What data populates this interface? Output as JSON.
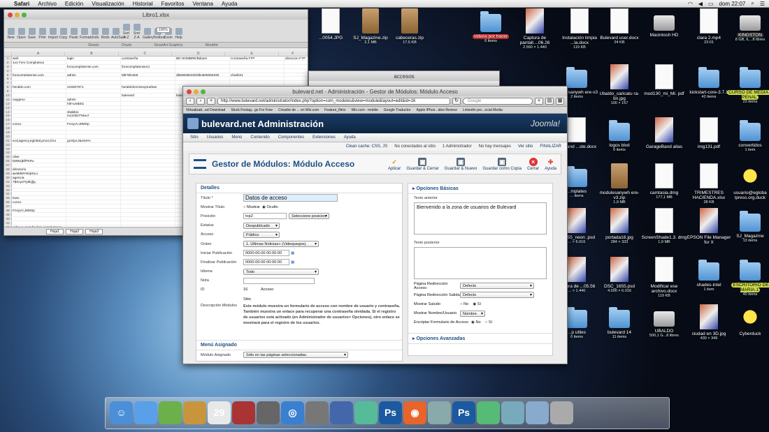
{
  "menubar": {
    "apple": "",
    "app": "Safari",
    "items": [
      "Archivo",
      "Edición",
      "Visualización",
      "Historial",
      "Favoritos",
      "Ventana",
      "Ayuda"
    ],
    "clock": "dom 22:07"
  },
  "excel": {
    "title": "Libro1.xlsx",
    "zoom": "100%",
    "toolbar": [
      "New",
      "Open",
      "Save",
      "Print",
      "Import",
      "Copy",
      "Paste",
      "Format",
      "Undo",
      "Redo",
      "AutoSum",
      "Sort A-Z",
      "Sort Z-A",
      "Gallery",
      "Toolbox",
      "Zoom",
      "Help"
    ],
    "ribbon": [
      "Sheets",
      "Charts",
      "SmartArt Graphics",
      "WordArt"
    ],
    "columns": [
      "A",
      "B",
      "C",
      "D",
      "E",
      "F"
    ],
    "rows": [
      [
        "web",
        "login",
        "contraseña",
        "BD NOMBRE/Bduser",
        "Contraseña FTP",
        "direccion FTP"
      ],
      [
        "1x1 Foro Compluteca",
        "",
        "",
        "",
        "",
        ""
      ],
      [
        "",
        "forocomplutense.com",
        "forocomplutense13",
        "",
        "",
        ""
      ],
      [
        "",
        "",
        "",
        "",
        "",
        ""
      ],
      [
        "forocomplutense.com",
        "admin",
        "Mk*9lmnk8",
        "db506056330/dbo506056330",
        "charliet1",
        ""
      ],
      [
        "",
        "",
        "",
        "",
        "",
        ""
      ],
      [
        "",
        "",
        "",
        "",
        "",
        ""
      ],
      [
        "heraldo.com",
        "218257971",
        "heraldoherrarecpruebas",
        "",
        "",
        ""
      ],
      [
        "",
        "",
        "",
        "",
        "",
        ""
      ],
      [
        "",
        "",
        "bulevard",
        "bulevard41",
        "3Ev9(@)P5d+QEd",
        ""
      ],
      [
        "oxygeno",
        "admin",
        "",
        "",
        "",
        ""
      ],
      [
        "",
        "hik*xJe$4t1",
        "",
        "",
        "",
        ""
      ],
      [
        "",
        "",
        "",
        "",
        "",
        ""
      ],
      [
        "",
        "sbabbio",
        "",
        "",
        "",
        ""
      ],
      [
        "",
        "mv)VkD7'Mvu7",
        "",
        "",
        "",
        ""
      ],
      [
        "",
        "",
        "",
        "",
        "",
        ""
      ],
      [
        "conco",
        "FnnyvV,J8MOp",
        "",
        "",
        "",
        ""
      ],
      [
        "",
        "",
        "",
        "",
        "",
        ""
      ],
      [
        "",
        "",
        "",
        "",
        "",
        ""
      ],
      [
        "",
        "",
        "",
        "",
        "",
        ""
      ],
      [
        "ecd,agency,eglobal,proxs,foro",
        "gUXjxL3&Jsm%",
        "",
        "",
        "",
        ""
      ],
      [
        "",
        "",
        "",
        "",
        "",
        ""
      ],
      [
        "",
        "",
        "",
        "",
        "",
        ""
      ],
      [
        "",
        "",
        "",
        "",
        "",
        ""
      ],
      [
        "olive",
        "",
        "",
        "",
        "",
        ""
      ],
      [
        "D8WxjEfPKRu",
        "",
        "",
        "",
        "",
        ""
      ],
      [
        "",
        "",
        "",
        "",
        "",
        ""
      ],
      [
        "directorio",
        "",
        "",
        "",
        "",
        ""
      ],
      [
        "&xMdMYWqHtLu",
        "",
        "",
        "",
        "",
        ""
      ],
      [
        "agencia",
        "",
        "",
        "",
        "",
        ""
      ],
      [
        "7$XcyOTy5kj||q",
        "",
        "",
        "",
        "",
        ""
      ],
      [
        "",
        "",
        "",
        "",
        "",
        ""
      ],
      [
        "",
        "",
        "",
        "",
        "",
        ""
      ],
      [
        "",
        "",
        "",
        "",
        "",
        ""
      ],
      [
        "lowo",
        "",
        "",
        "",
        "",
        ""
      ],
      [
        "conco",
        "",
        "",
        "",
        "",
        ""
      ],
      [
        "",
        "",
        "",
        "",
        "",
        ""
      ],
      [
        "FnnyvV,J8MOp",
        "",
        "",
        "",
        "",
        ""
      ],
      [
        "",
        "",
        "",
        "",
        "",
        ""
      ],
      [
        "",
        "",
        "",
        "",
        "",
        ""
      ],
      [
        "",
        "",
        "",
        "",
        "",
        ""
      ],
      [
        "video a youtube foro complutense",
        "",
        "",
        "",
        "",
        ""
      ],
      [
        "qj7vr6vTIR%ojm.youtube.com",
        "",
        "",
        "",
        "",
        ""
      ]
    ],
    "sheets": [
      "Hoja1",
      "Hoja2",
      "Hoja3"
    ]
  },
  "finder": {
    "title": "accesos"
  },
  "browser": {
    "title": "bulevard.net - Administración - Gestor de Módulos: Módulo Acceso",
    "url": "http://www.bulevard.net/administrator/index.php?option=com_modules&view=module&layout=edit&id=16",
    "search_placeholder": "Google",
    "bookmarks": [
      "Virtualizati...ed Download",
      "Stock Footag...go For Free",
      "Creador de ... en Wix.com",
      "Feature_films",
      "Wix.com - mobile",
      "Google Traductor",
      "Apple iPhon...ideo Review",
      "LinkedIn pro...ocial Media"
    ],
    "site_name": "bulevard.net Administración",
    "joomla": "Joomla!",
    "menu": [
      "Sitio",
      "Usuarios",
      "Menú",
      "Contenido",
      "Componentes",
      "Extensiones",
      "Ayuda"
    ],
    "status": [
      "Clean cache: CSS, JS",
      "No conectados al sitio",
      "1 Administrador",
      "No hay mensajes",
      "Ver sitio",
      "FINALIZAR"
    ],
    "page_title": "Gestor de Módulos: Módulo Acceso",
    "tools": [
      "Aplicar",
      "Guardar & Cerrar",
      "Guardar & Nuevo",
      "Guardar como Copia",
      "Cerrar",
      "Ayuda"
    ],
    "details": {
      "header": "Detalles",
      "titulo_label": "Título",
      "titulo": "Datos de acceso",
      "mostrar_label": "Mostrar Título",
      "mostrar": "Mostrar",
      "oculto": "Oculto",
      "posicion_label": "Posición",
      "posicion": "top2",
      "sel_pos": "Seleccione posicion",
      "estatus_label": "Estatus",
      "estatus": "Despublicado",
      "acceso_label": "Acceso",
      "acceso": "Público",
      "orden_label": "Orden",
      "orden": "1. Ultimas Noticias+ (Videojuegos)",
      "inicio_label": "Iniciar Publicación",
      "inicio": "0000-00-00 00:00:00",
      "fin_label": "Finalizar Publicación",
      "fin": "0000-00-00 00:00:00",
      "idioma_label": "Idioma",
      "idioma": "Todo",
      "nota_label": "Nota",
      "id_label": "ID",
      "id": "16",
      "id_type": "Acceso",
      "id_site": "Sitio",
      "desc_label": "Descripción Módulos",
      "desc": "Este módulo muestra un formulario de acceso con nombre de usuario y contraseña. También muestra un enlace para recuperar una contraseña olvidada. Si el registro de usuarios está activado (en Administrador de usuarios> Opciones), otro enlace se mostrará para el registro de los usuarios."
    },
    "asignado": {
      "header": "Menú Asignado",
      "label": "Módulo Asignado",
      "value": "Sólo en las páginas seleccionadas."
    },
    "opciones": {
      "header": "Opciones Básicas",
      "pre_label": "Texto anterior",
      "pre": "Bienvenido a la zona de usuarios de Bulevard",
      "post_label": "Texto posterior",
      "redir_in_label": "Página Redirección Acceso",
      "redir_in": "Defecto",
      "redir_out_label": "Página Redirección Salida",
      "redir_out": "Defecto",
      "saludo_label": "Mostrar Saludo",
      "no": "No",
      "si": "Sí",
      "nombre_label": "Mostrar Nombre/Usuario",
      "nombre": "Nombre",
      "encrypt_label": "Encriptar Formulario de Acceso",
      "avanzadas": "Opciones Avanzadas"
    }
  },
  "desktop": [
    {
      "name": "...0054.JPG",
      "sub": ""
    },
    {
      "name": "SJ_Magazine.zip",
      "sub": "2,1 MB"
    },
    {
      "name": "cabeceras.zip",
      "sub": "17,5 KB"
    },
    {
      "name": "videos por hacer",
      "sub": "6 items"
    },
    {
      "name": "Captura de pantall....06.26",
      "sub": "2.560 × 1.440"
    },
    {
      "name": "Instalación limpia ...la.docx",
      "sub": "119 KB"
    },
    {
      "name": "Bulevard user.docx",
      "sub": "24 KB"
    },
    {
      "name": "Macintosh HD",
      "sub": ""
    },
    {
      "name": "clara 2.mp4",
      "sub": "23:01"
    },
    {
      "name": "KINGSTON",
      "sub": "8 GB, 6,...8 libres"
    },
    {
      "name": "...dulesanywh ere-v3",
      "sub": "2 items"
    },
    {
      "name": "Ubaldo_caricatu ra-bn.jpg",
      "sub": "100 × 157"
    },
    {
      "name": "mod130_mi_MI. pdf",
      "sub": ""
    },
    {
      "name": "kickstart-core-3.7.1",
      "sub": "42 items"
    },
    {
      "name": "CURSO DE MEDIA ... PENAL",
      "sub": "23 items"
    },
    {
      "name": "...py and ...ste.docx",
      "sub": ""
    },
    {
      "name": "logos blvd",
      "sub": "6 items"
    },
    {
      "name": "GarageBand alias",
      "sub": ""
    },
    {
      "name": "img131.pdf",
      "sub": ""
    },
    {
      "name": "convertidos",
      "sub": "1 item"
    },
    {
      "name": "...mplates",
      "sub": "... items"
    },
    {
      "name": "modulesanywh ere-v3.zip",
      "sub": "1,9 MB"
    },
    {
      "name": "camtasia.dmg",
      "sub": "177,1 MB"
    },
    {
      "name": "TRIMESTRES HACIENDA.xlsx",
      "sub": "28 KB"
    },
    {
      "name": "usuario@egloba lpress.org.duck",
      "sub": ""
    },
    {
      "name": "...1655_neon .psd",
      "sub": "... × 6.016"
    },
    {
      "name": "portada16.jpg",
      "sub": "284 × 333"
    },
    {
      "name": "ScreenShade1.3. dmg",
      "sub": "1,9 MB"
    },
    {
      "name": "EPSON File Manager for X",
      "sub": ""
    },
    {
      "name": "SJ_Magazine",
      "sub": "13 items"
    },
    {
      "name": "...ptura de ...05.56",
      "sub": "... × 1.440"
    },
    {
      "name": "DSC_1655.psd",
      "sub": "4.000 × 6.016"
    },
    {
      "name": "Modificar ese archivo.docx",
      "sub": "119 KB"
    },
    {
      "name": "shades-intel",
      "sub": "1 item"
    },
    {
      "name": "ESCRITORIO DE MARIA.1",
      "sub": "40 items"
    },
    {
      "name": "...p utiles",
      "sub": "6 items"
    },
    {
      "name": "bulevard 14",
      "sub": "11 items"
    },
    {
      "name": "UBALDO",
      "sub": "500,1 G...8 libres"
    },
    {
      "name": "ciudad en 3D.jpg",
      "sub": "430 × 349"
    },
    {
      "name": "Cyberduck",
      "sub": ""
    }
  ],
  "dock": [
    "Finder",
    "FaceTime",
    "Rastreador",
    "Contactos",
    "Calendario",
    "Photo Booth",
    "Aperture",
    "Safari",
    "Time Machine",
    "iTunes",
    "Vista Previa",
    "Photoshop",
    "Firefox",
    "Correo",
    "Photoshop",
    "Colloquy",
    "Aplicaciones",
    "Documentos",
    "Papelera"
  ]
}
